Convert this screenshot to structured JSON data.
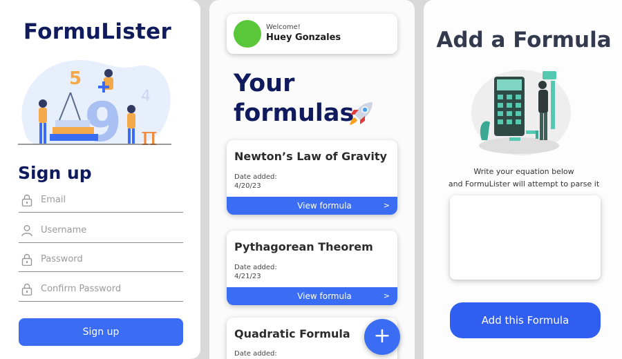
{
  "signup_screen": {
    "app_title": "FormuLister",
    "heading": "Sign up",
    "fields": [
      {
        "placeholder": "Email",
        "icon": "lock-icon"
      },
      {
        "placeholder": "Username",
        "icon": "user-icon"
      },
      {
        "placeholder": "Password",
        "icon": "lock-icon"
      },
      {
        "placeholder": "Confirm Password",
        "icon": "lock-icon"
      }
    ],
    "submit_label": "Sign up"
  },
  "formulas_screen": {
    "welcome": "Welcome!",
    "user_name": "Huey Gonzales",
    "heading_line1": "Your",
    "heading_line2": "formulas",
    "cards": [
      {
        "name": "Newton’s Law of Gravity",
        "date_label": "Date added:",
        "date": "4/20/23",
        "action": "View formula"
      },
      {
        "name": "Pythagorean Theorem",
        "date_label": "Date added:",
        "date": "4/21/23",
        "action": "View formula"
      },
      {
        "name": "Quadratic Formula",
        "date_label": "Date added:"
      }
    ],
    "fab_label": "+"
  },
  "add_screen": {
    "title": "Add a Formula",
    "instruction_line1": "Write your equation below",
    "instruction_line2": "and FormuLister will attempt to parse it",
    "submit_label": "Add this Formula"
  },
  "colors": {
    "accent_blue": "#3a6cf4",
    "navy": "#0f1b5c",
    "avatar_green": "#5ac63a"
  }
}
